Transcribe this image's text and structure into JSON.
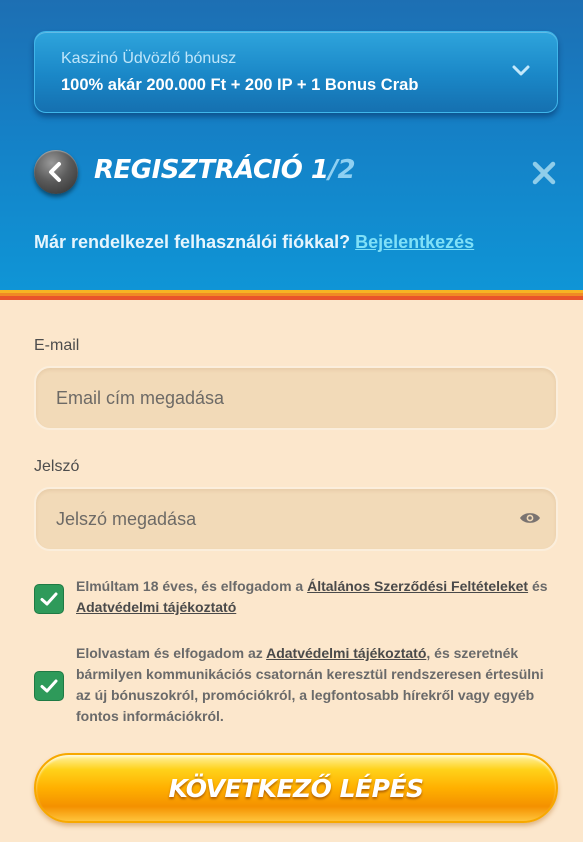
{
  "bonus": {
    "title": "Kaszinó Üdvözlő bónusz",
    "description": "100% akár 200.000 Ft + 200 IP + 1 Bonus Crab"
  },
  "header": {
    "title_main": "REGISZTRÁCIÓ 1",
    "title_step": "/2",
    "login_prompt": "Már rendelkezel felhasználói fiókkal?",
    "login_link": "Bejelentkezés"
  },
  "form": {
    "email_label": "E-mail",
    "email_placeholder": "Email cím megadása",
    "password_label": "Jelszó",
    "password_placeholder": "Jelszó megadása"
  },
  "consents": {
    "age": {
      "checked": true,
      "text_before": "Elmúltam 18 éves, és elfogadom a ",
      "link1": "Általános Szerződési Feltételeket",
      "text_mid": " és ",
      "link2": "Adatvédelmi tájékoztató"
    },
    "marketing": {
      "checked": true,
      "text_before": "Elolvastam és elfogadom az ",
      "link": "Adatvédelmi tájékoztató",
      "text_after": ", és szeretnék bármilyen kommunikációs csatornán keresztül rendszeresen értesülni az új bónuszokról, promóciókról, a legfontosabb hírekről vagy egyéb fontos információkról."
    }
  },
  "next_button": "KÖVETKEZŐ LÉPÉS",
  "colors": {
    "header_blue": "#1580c6",
    "form_background": "#fce7cc",
    "checkbox_green": "#2e9a5a",
    "button_orange": "#ffb000"
  }
}
